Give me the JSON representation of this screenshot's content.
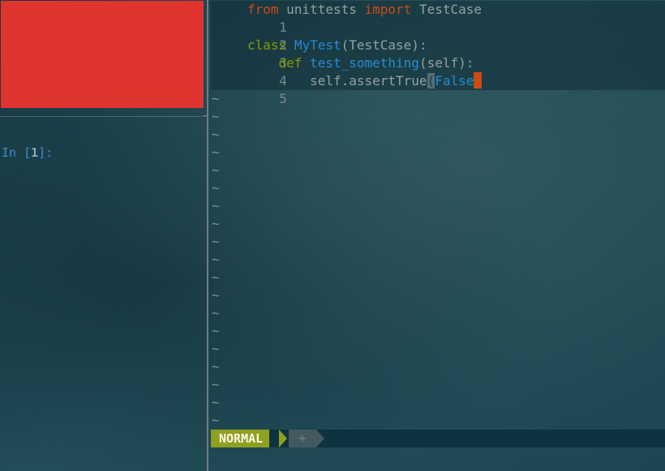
{
  "colors": {
    "accent_red": "#e03431",
    "keyword_orange": "#cb4b16",
    "keyword_green": "#859900",
    "name_blue": "#268bd2",
    "mode_green": "#8fa021"
  },
  "notebook": {
    "prompt_prefix": "In [",
    "prompt_number": "1",
    "prompt_suffix": "]:"
  },
  "editor": {
    "lines": [
      {
        "num": "1",
        "t": [
          "from",
          " unittests ",
          "import",
          " TestCase"
        ]
      },
      {
        "num": "2",
        "t": []
      },
      {
        "num": "3",
        "t": [
          "class",
          " ",
          "MyTest",
          "(TestCase):"
        ]
      },
      {
        "num": "4",
        "t": [
          "    ",
          "def",
          " ",
          "test_something",
          "(self):"
        ]
      },
      {
        "num": "5",
        "t": [
          "        self.assertTrue",
          "(",
          "False"
        ]
      }
    ],
    "tilde": "~",
    "status": {
      "mode": "NORMAL",
      "secondary_segment": "+"
    }
  }
}
